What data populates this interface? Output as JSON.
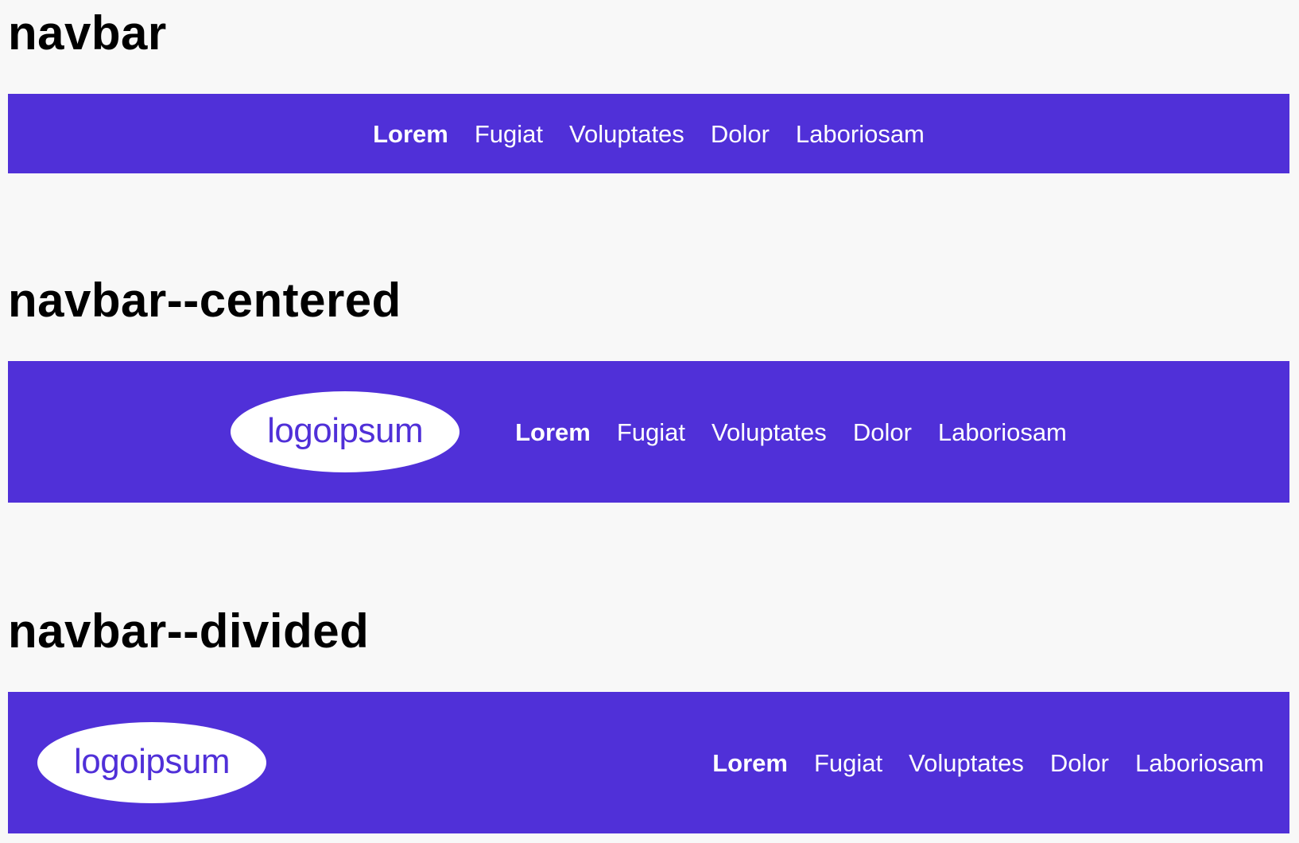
{
  "sections": [
    {
      "title": "navbar",
      "nav_links": [
        "Lorem",
        "Fugiat",
        "Voluptates",
        "Dolor",
        "Laboriosam"
      ]
    },
    {
      "title": "navbar--centered",
      "logo_text": "logoipsum",
      "nav_links": [
        "Lorem",
        "Fugiat",
        "Voluptates",
        "Dolor",
        "Laboriosam"
      ]
    },
    {
      "title": "navbar--divided",
      "logo_text": "logoipsum",
      "nav_links": [
        "Lorem",
        "Fugiat",
        "Voluptates",
        "Dolor",
        "Laboriosam"
      ]
    }
  ],
  "active_link": "Lorem",
  "colors": {
    "navbar_background": "#5030d8",
    "page_background": "#f8f8f8",
    "nav_text": "#ffffff",
    "logo_background": "#ffffff",
    "logo_text": "#5030d8",
    "heading_text": "#000000"
  }
}
